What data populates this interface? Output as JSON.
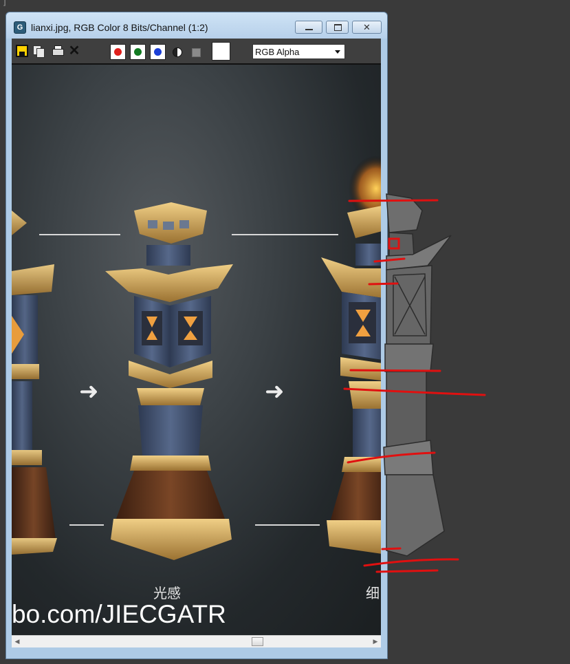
{
  "window": {
    "title": "lianxi.jpg, RGB Color 8 Bits/Channel (1:2)",
    "app_icon": "G",
    "close_glyph": "✕"
  },
  "toolbar": {
    "icons": [
      "save-icon",
      "copy-icon",
      "print-icon",
      "clear-icon"
    ],
    "clear_glyph": "✕",
    "channels": [
      {
        "name": "red",
        "color": "#e0201c"
      },
      {
        "name": "green",
        "color": "#127a22"
      },
      {
        "name": "blue",
        "color": "#1b3fd6"
      }
    ],
    "display_mode": "RGB Alpha"
  },
  "canvas": {
    "arrow_glyph": "➜",
    "captions": [
      "光感",
      "细"
    ],
    "watermark": "bo.com/JIECGATR"
  },
  "scrollbar": {
    "left_glyph": "◀",
    "right_glyph": "▶"
  },
  "corner_glyph": "]",
  "colors": {
    "desktop": "#3a3a3a",
    "titlebar": "#b6d0ea",
    "annotation_red": "#e01010",
    "gold": "#c8a050",
    "stone_blue": "#4b5a78",
    "wood": "#6a3a1e",
    "untextured_gray": "#6e6e6e"
  }
}
